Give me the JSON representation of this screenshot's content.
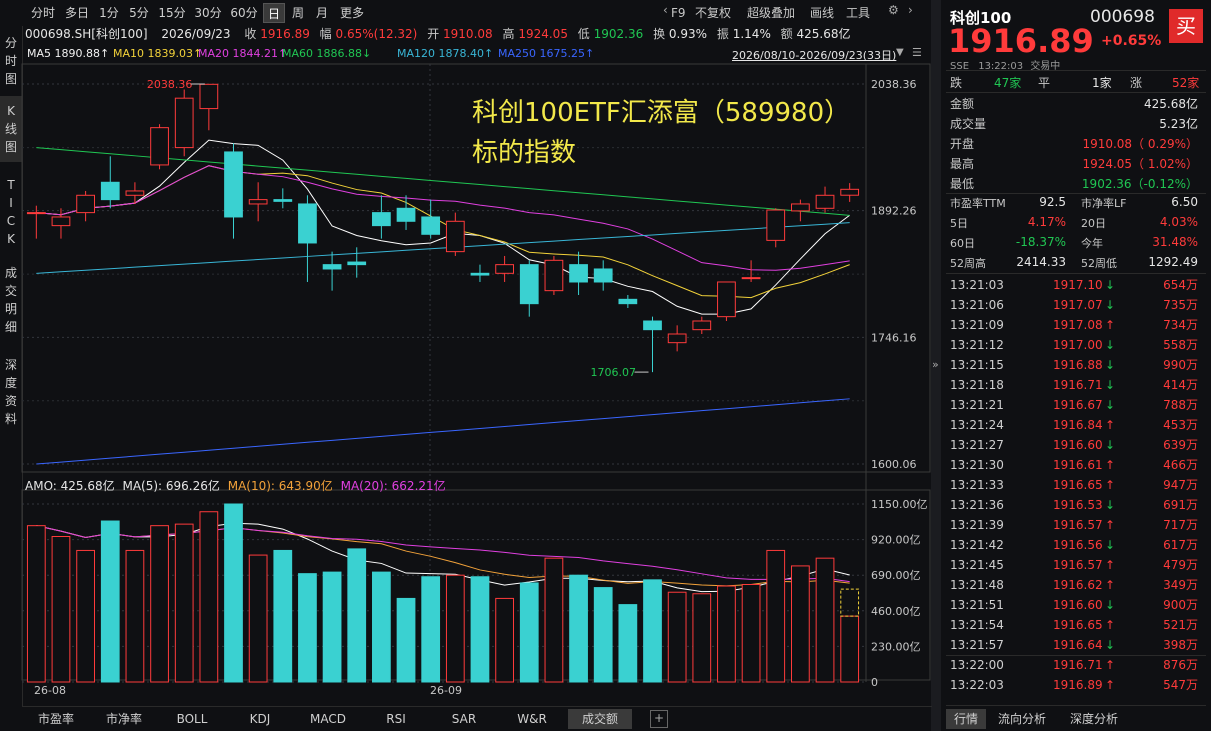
{
  "toolbar": {
    "periods": [
      "分时",
      "多日",
      "1分",
      "5分",
      "15分",
      "30分",
      "60分",
      "日",
      "周",
      "月",
      "更多"
    ],
    "active_period": "日",
    "right_items": [
      "F9",
      "不复权",
      "超级叠加",
      "画线",
      "工具"
    ]
  },
  "left_nav": {
    "items": [
      {
        "label": "分\n时\n图"
      },
      {
        "label": "K\n线\n图"
      },
      {
        "label": "T\nI\nC\nK"
      },
      {
        "label": "成\n交\n明\n细"
      },
      {
        "label": "深\n度\n资\n料"
      }
    ]
  },
  "info_bar": {
    "code": "000698.SH[科创100]",
    "date": "2026/09/23",
    "close_label": "收",
    "close": "1916.89",
    "amp_label": "幅",
    "amp": "0.65%(12.32)",
    "open_label": "开",
    "open": "1910.08",
    "high_label": "高",
    "high": "1924.05",
    "low_label": "低",
    "low": "1902.36",
    "turnover_label": "换",
    "turnover": "0.93%",
    "swing_label": "振",
    "swing": "1.14%",
    "amount_label": "额",
    "amount": "425.68亿"
  },
  "ma_bar": {
    "ma5": "MA5 1890.88↑",
    "ma10": "MA10 1839.03↑",
    "ma20": "MA20 1844.21↑",
    "ma60": "MA60 1886.88↓",
    "ma120": "MA120 1878.40↑",
    "ma250": "MA250 1675.25↑",
    "range": "2026/08/10-2026/09/23(33日)"
  },
  "chart_overlay": {
    "title_line1": "科创100ETF汇添富（589980）",
    "title_line2": "标的指数",
    "high_mark": "2038.36",
    "low_mark": "1706.07"
  },
  "volume_bar": {
    "amo": "AMO: 425.68亿",
    "ma5": "MA(5): 696.26亿",
    "ma10": "MA(10): 643.90亿",
    "ma20": "MA(20): 662.21亿"
  },
  "date_labels": [
    "26-08",
    "26-09"
  ],
  "bottom_tabs": [
    "市盈率",
    "市净率",
    "BOLL",
    "KDJ",
    "MACD",
    "RSI",
    "SAR",
    "W&R",
    "成交额"
  ],
  "active_bottom_tab": "成交额",
  "quote": {
    "name": "科创100",
    "code": "000698",
    "price": "1916.89",
    "change": "+0.65%",
    "buy_button": "买",
    "exchange": "SSE",
    "time": "13:22:03",
    "status": "交易中",
    "breadth": {
      "down_label": "跌",
      "down": "47家",
      "flat_label": "平",
      "flat": "1家",
      "up_label": "涨",
      "up": "52家"
    },
    "stats": [
      {
        "label": "金额",
        "value": "425.68亿",
        "color": "#e6e6e6"
      },
      {
        "label": "成交量",
        "value": "5.23亿",
        "color": "#e6e6e6"
      },
      {
        "label": "开盘",
        "value": "1910.08（ 0.29%）",
        "color": "#ff3b3b"
      },
      {
        "label": "最高",
        "value": "1924.05（ 1.02%）",
        "color": "#ff3b3b"
      },
      {
        "label": "最低",
        "value": "1902.36（-0.12%）",
        "color": "#20c653"
      }
    ],
    "pairs": [
      {
        "l1": "市盈率TTM",
        "v1": "92.5",
        "c1": "#e6e6e6",
        "l2": "市净率LF",
        "v2": "6.50",
        "c2": "#e6e6e6"
      },
      {
        "l1": "5日",
        "v1": "4.17%",
        "c1": "#ff3b3b",
        "l2": "20日",
        "v2": "4.03%",
        "c2": "#ff3b3b"
      },
      {
        "l1": "60日",
        "v1": "-18.37%",
        "c1": "#20c653",
        "l2": "今年",
        "v2": "31.48%",
        "c2": "#ff3b3b"
      },
      {
        "l1": "52周高",
        "v1": "2414.33",
        "c1": "#e6e6e6",
        "l2": "52周低",
        "v2": "1292.49",
        "c2": "#e6e6e6"
      }
    ]
  },
  "ticks": [
    {
      "time": "13:21:03",
      "price": "1917.10",
      "dir": "↓",
      "vol": "654万"
    },
    {
      "time": "13:21:06",
      "price": "1917.07",
      "dir": "↓",
      "vol": "735万"
    },
    {
      "time": "13:21:09",
      "price": "1917.08",
      "dir": "↑",
      "vol": "734万"
    },
    {
      "time": "13:21:12",
      "price": "1917.00",
      "dir": "↓",
      "vol": "558万"
    },
    {
      "time": "13:21:15",
      "price": "1916.88",
      "dir": "↓",
      "vol": "990万"
    },
    {
      "time": "13:21:18",
      "price": "1916.71",
      "dir": "↓",
      "vol": "414万"
    },
    {
      "time": "13:21:21",
      "price": "1916.67",
      "dir": "↓",
      "vol": "788万"
    },
    {
      "time": "13:21:24",
      "price": "1916.84",
      "dir": "↑",
      "vol": "453万"
    },
    {
      "time": "13:21:27",
      "price": "1916.60",
      "dir": "↓",
      "vol": "639万"
    },
    {
      "time": "13:21:30",
      "price": "1916.61",
      "dir": "↑",
      "vol": "466万"
    },
    {
      "time": "13:21:33",
      "price": "1916.65",
      "dir": "↑",
      "vol": "947万"
    },
    {
      "time": "13:21:36",
      "price": "1916.53",
      "dir": "↓",
      "vol": "691万"
    },
    {
      "time": "13:21:39",
      "price": "1916.57",
      "dir": "↑",
      "vol": "717万"
    },
    {
      "time": "13:21:42",
      "price": "1916.56",
      "dir": "↓",
      "vol": "617万"
    },
    {
      "time": "13:21:45",
      "price": "1916.57",
      "dir": "↑",
      "vol": "479万"
    },
    {
      "time": "13:21:48",
      "price": "1916.62",
      "dir": "↑",
      "vol": "349万"
    },
    {
      "time": "13:21:51",
      "price": "1916.60",
      "dir": "↓",
      "vol": "900万"
    },
    {
      "time": "13:21:54",
      "price": "1916.65",
      "dir": "↑",
      "vol": "521万"
    },
    {
      "time": "13:21:57",
      "price": "1916.64",
      "dir": "↓",
      "vol": "398万"
    },
    {
      "time": "13:22:00",
      "price": "1916.71",
      "dir": "↑",
      "vol": "876万"
    },
    {
      "time": "13:22:03",
      "price": "1916.89",
      "dir": "↑",
      "vol": "547万"
    }
  ],
  "right_tabs": [
    "行情",
    "流向分析",
    "深度分析"
  ],
  "active_right_tab": "行情",
  "colors": {
    "up": "#ff3b3b",
    "down": "#3ad1d1",
    "ma5": "#ffffff",
    "ma10": "#f2d23a",
    "ma20": "#e040e0",
    "ma60": "#20c653",
    "ma120": "#39b6d6",
    "ma250": "#3a66ff"
  },
  "chart_data": {
    "type": "candlestick",
    "y_ticks": [
      "2038.36",
      "1892.26",
      "1746.16",
      "1600.06"
    ],
    "ylim": [
      1600.06,
      2038.36
    ],
    "x_labels": [
      "26-08",
      "26-09"
    ],
    "candles": [
      {
        "o": 1890,
        "h": 1898,
        "l": 1860,
        "c": 1890
      },
      {
        "o": 1875,
        "h": 1895,
        "l": 1860,
        "c": 1885
      },
      {
        "o": 1890,
        "h": 1915,
        "l": 1880,
        "c": 1910
      },
      {
        "o": 1925,
        "h": 1955,
        "l": 1895,
        "c": 1905
      },
      {
        "o": 1910,
        "h": 1925,
        "l": 1900,
        "c": 1915
      },
      {
        "o": 1945,
        "h": 1992,
        "l": 1940,
        "c": 1988
      },
      {
        "o": 1965,
        "h": 2032,
        "l": 1955,
        "c": 2022
      },
      {
        "o": 2010,
        "h": 2038.36,
        "l": 1985,
        "c": 2038
      },
      {
        "o": 1960,
        "h": 1970,
        "l": 1860,
        "c": 1885
      },
      {
        "o": 1900,
        "h": 1925,
        "l": 1880,
        "c": 1905
      },
      {
        "o": 1905,
        "h": 1918,
        "l": 1895,
        "c": 1903
      },
      {
        "o": 1900,
        "h": 1910,
        "l": 1810,
        "c": 1855
      },
      {
        "o": 1830,
        "h": 1845,
        "l": 1800,
        "c": 1825
      },
      {
        "o": 1833,
        "h": 1850,
        "l": 1815,
        "c": 1830
      },
      {
        "o": 1890,
        "h": 1910,
        "l": 1860,
        "c": 1875
      },
      {
        "o": 1895,
        "h": 1910,
        "l": 1870,
        "c": 1880
      },
      {
        "o": 1885,
        "h": 1905,
        "l": 1860,
        "c": 1865
      },
      {
        "o": 1845,
        "h": 1890,
        "l": 1840,
        "c": 1880
      },
      {
        "o": 1820,
        "h": 1830,
        "l": 1810,
        "c": 1818
      },
      {
        "o": 1820,
        "h": 1840,
        "l": 1810,
        "c": 1830
      },
      {
        "o": 1830,
        "h": 1835,
        "l": 1770,
        "c": 1785
      },
      {
        "o": 1800,
        "h": 1840,
        "l": 1795,
        "c": 1835
      },
      {
        "o": 1830,
        "h": 1845,
        "l": 1795,
        "c": 1810
      },
      {
        "o": 1825,
        "h": 1835,
        "l": 1800,
        "c": 1810
      },
      {
        "o": 1790,
        "h": 1795,
        "l": 1780,
        "c": 1785
      },
      {
        "o": 1765,
        "h": 1770,
        "l": 1706.07,
        "c": 1755
      },
      {
        "o": 1740,
        "h": 1760,
        "l": 1730,
        "c": 1750
      },
      {
        "o": 1755,
        "h": 1770,
        "l": 1750,
        "c": 1765
      },
      {
        "o": 1770,
        "h": 1810,
        "l": 1765,
        "c": 1810
      },
      {
        "o": 1815,
        "h": 1835,
        "l": 1810,
        "c": 1815
      },
      {
        "o": 1858,
        "h": 1895,
        "l": 1850,
        "c": 1893
      },
      {
        "o": 1892,
        "h": 1905,
        "l": 1880,
        "c": 1900
      },
      {
        "o": 1895,
        "h": 1920,
        "l": 1890,
        "c": 1910
      },
      {
        "o": 1910.08,
        "h": 1924.05,
        "l": 1902.36,
        "c": 1916.89
      }
    ],
    "volume_y_ticks": [
      "1150.00亿",
      "920.00亿",
      "690.00亿",
      "460.00亿",
      "230.00亿",
      "0"
    ],
    "volume_ylim": [
      0,
      1150
    ],
    "volumes": [
      1010,
      940,
      850,
      1040,
      850,
      1010,
      1020,
      1100,
      1150,
      820,
      850,
      700,
      710,
      860,
      710,
      540,
      680,
      690,
      680,
      540,
      640,
      800,
      690,
      610,
      500,
      660,
      580,
      570,
      620,
      630,
      850,
      750,
      800,
      425.68
    ]
  }
}
